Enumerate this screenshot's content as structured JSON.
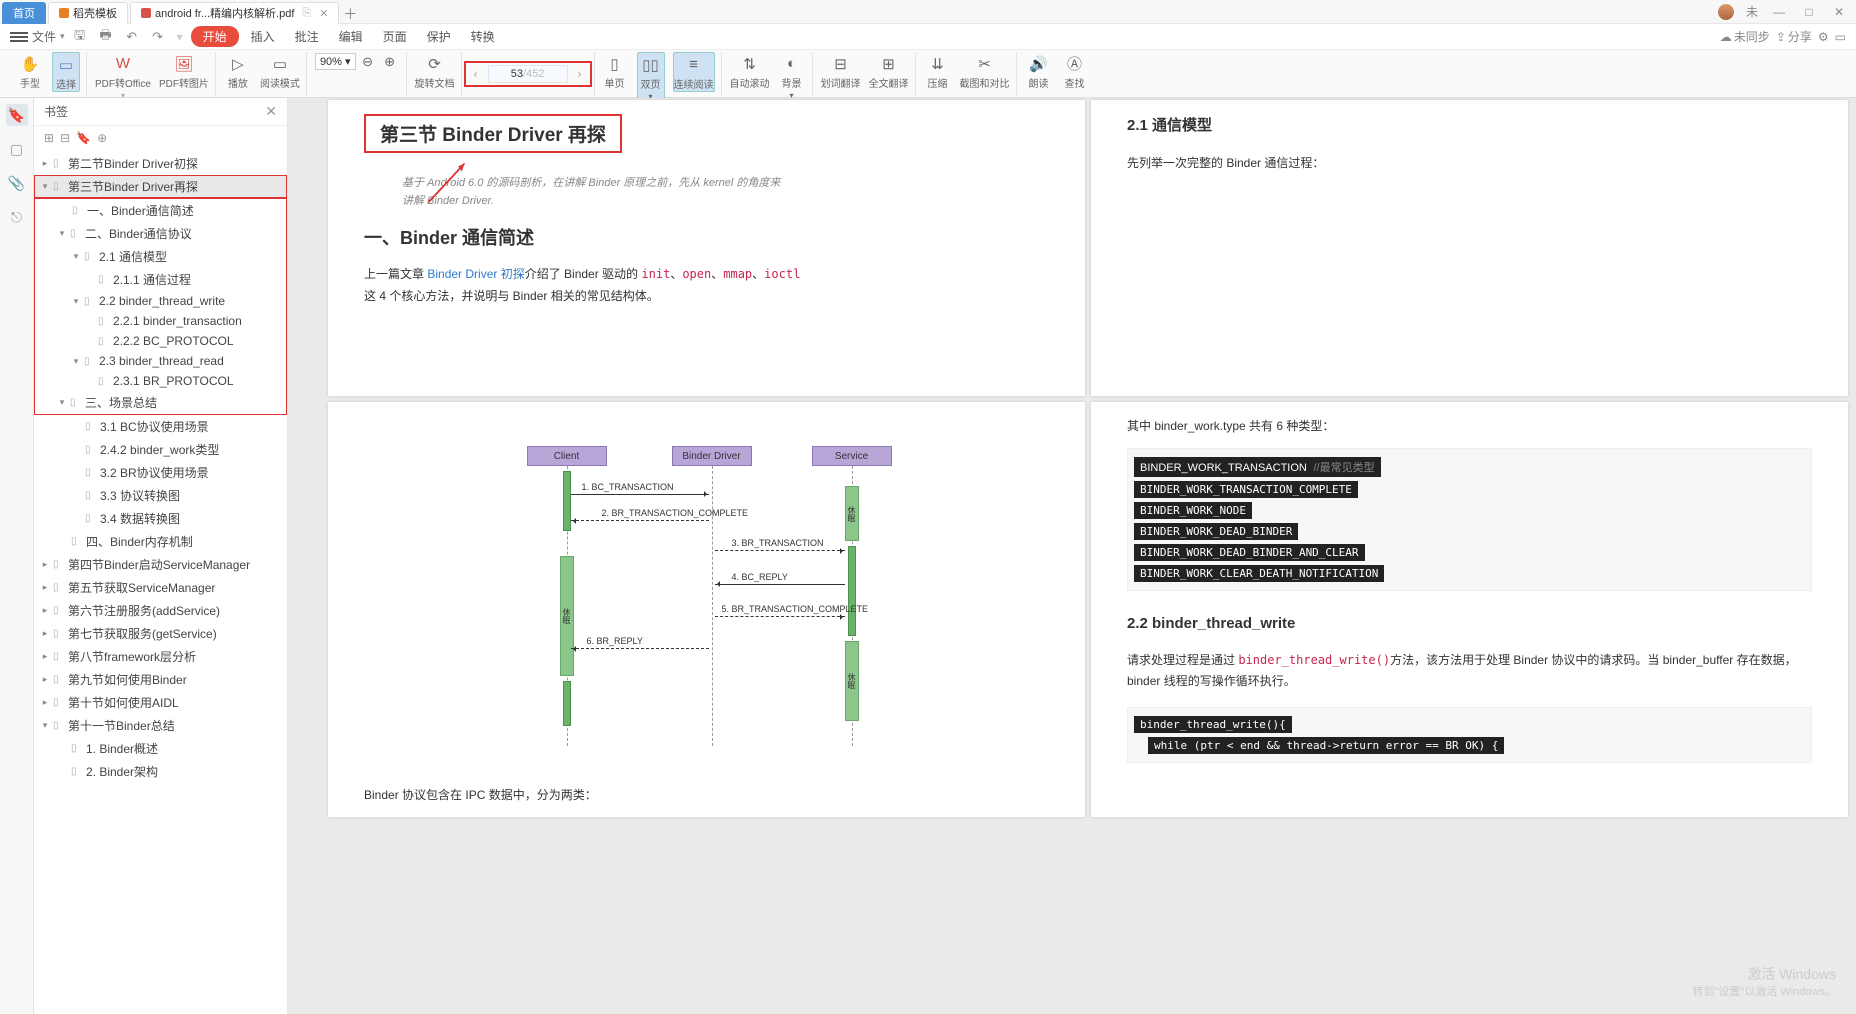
{
  "tabs": {
    "home": "首页",
    "template": "稻壳模板",
    "pdf": "android fr...精编内核解析.pdf"
  },
  "user": {
    "name": "未"
  },
  "winbtns": {
    "min": "—",
    "max": "□",
    "close": "✕"
  },
  "menubar": {
    "file": "文件",
    "start": "开始",
    "insert": "插入",
    "annot": "批注",
    "edit": "编辑",
    "page": "页面",
    "protect": "保护",
    "convert": "转换",
    "right_unsync": "未同步",
    "right_share": "分享"
  },
  "toolbar": {
    "hand": "手型",
    "select": "选择",
    "pdf_office": "PDF转Office",
    "pdf_pic": "PDF转图片",
    "play": "播放",
    "read_mode": "阅读模式",
    "zoom_value": "90%",
    "rotate": "旋转文档",
    "single": "单页",
    "double": "双页",
    "continuous": "连续阅读",
    "page_cur": "53",
    "page_total": "/452",
    "auto_scroll": "自动滚动",
    "bg": "背景",
    "word_trans": "划词翻译",
    "full_trans": "全文翻译",
    "compress": "压缩",
    "crop_compare": "截图和对比",
    "read_aloud": "朗读",
    "find": "查找"
  },
  "sidebar": {
    "title": "书签",
    "items": {
      "s2": "第二节Binder Driver初探",
      "s3": "第三节Binder Driver再探",
      "s3_1": "一、Binder通信简述",
      "s3_2": "二、Binder通信协议",
      "s3_2_1": "2.1 通信模型",
      "s3_2_1_1": "2.1.1 通信过程",
      "s3_2_2": "2.2 binder_thread_write",
      "s3_2_2_1": "2.2.1 binder_transaction",
      "s3_2_2_2": "2.2.2 BC_PROTOCOL",
      "s3_2_3": "2.3 binder_thread_read",
      "s3_2_3_1": "2.3.1 BR_PROTOCOL",
      "s3_3": "三、场景总结",
      "s3_3_1": "3.1 BC协议使用场景",
      "s3_3_2": "2.4.2 binder_work类型",
      "s3_3_3": "3.2 BR协议使用场景",
      "s3_3_4": "3.3 协议转换图",
      "s3_3_5": "3.4 数据转换图",
      "s3_4": "四、Binder内存机制",
      "s4": "第四节Binder启动ServiceManager",
      "s5": "第五节获取ServiceManager",
      "s6": "第六节注册服务(addService)",
      "s7": "第七节获取服务(getService)",
      "s8": "第八节framework层分析",
      "s9": "第九节如何使用Binder",
      "s10": "第十节如何使用AIDL",
      "s11": "第十一节Binder总结",
      "s11_1": "1. Binder概述",
      "s11_2": "2. Binder架构"
    }
  },
  "doc": {
    "p1_left": {
      "title": "第三节 Binder Driver 再探",
      "intro1": "基于 Android 6.0 的源码剖析，在讲解 Binder 原理之前，先从 kernel 的角度来",
      "intro2": "讲解 Binder Driver.",
      "h2": "一、Binder 通信简述",
      "para1a": "上一篇文章 ",
      "para1_link": "Binder Driver 初探",
      "para1b": "介绍了 Binder 驱动的 ",
      "code1": "init",
      "code2": "open",
      "code3": "mmap",
      "code4": "ioctl",
      "para1c": "这 4 个核心方法，并说明与 Binder 相关的常见结构体。"
    },
    "p1_right": {
      "h3": "2.1  通信模型",
      "txt": "先列举一次完整的 Binder 通信过程："
    },
    "p2_left": {
      "seq": {
        "client": "Client",
        "driver": "Binder Driver",
        "service": "Service",
        "rest": "休眠",
        "m1": "1. BC_TRANSACTION",
        "m2": "2. BR_TRANSACTION_COMPLETE",
        "m3": "3. BR_TRANSACTION",
        "m4": "4. BC_REPLY",
        "m5": "5. BR_TRANSACTION_COMPLETE",
        "m6": "6. BR_REPLY"
      },
      "bottom": "Binder 协议包含在 IPC 数据中，分为两类："
    },
    "p2_right": {
      "txt1": "其中 binder_work.type 共有 6 种类型：",
      "c1": "BINDER_WORK_TRANSACTION",
      "c1c": "//最常见类型",
      "c2": "BINDER_WORK_TRANSACTION_COMPLETE",
      "c3": "BINDER_WORK_NODE",
      "c4": "BINDER_WORK_DEAD_BINDER",
      "c5": "BINDER_WORK_DEAD_BINDER_AND_CLEAR",
      "c6": "BINDER_WORK_CLEAR_DEATH_NOTIFICATION",
      "h3": "2.2 binder_thread_write",
      "txt2a": "请求处理过程是通过 ",
      "txt2code": "binder_thread_write()",
      "txt2b": "方法，该方法用于处理 Binder 协议中的请求码。当 binder_buffer 存在数据，binder 线程的写操作循环执行。",
      "code_sig": "binder_thread_write(){",
      "code_while": "while (ptr < end && thread->return error == BR OK) {"
    }
  },
  "watermark": {
    "l1": "激活 Windows",
    "l2": "转到\"设置\"以激活 Windows。"
  }
}
